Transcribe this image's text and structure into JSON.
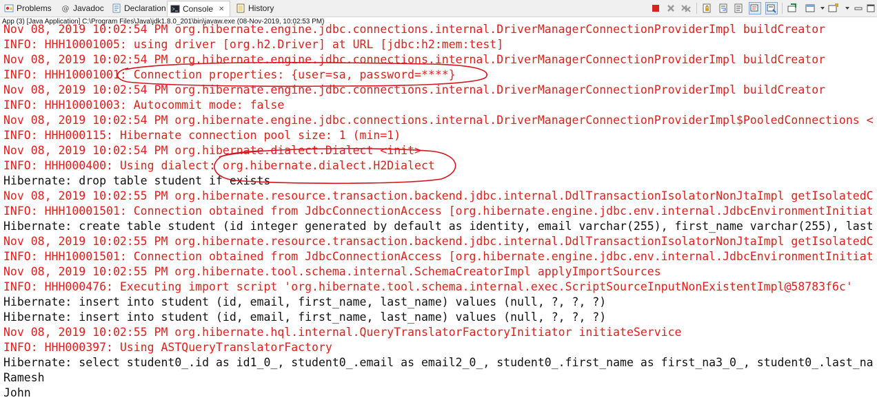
{
  "tabs": [
    {
      "label": "Problems",
      "icon": "problems-icon",
      "active": false
    },
    {
      "label": "Javadoc",
      "icon": "at-icon",
      "active": false
    },
    {
      "label": "Declaration",
      "icon": "declaration-icon",
      "active": false
    },
    {
      "label": "Console",
      "icon": "console-icon",
      "active": true
    },
    {
      "label": "History",
      "icon": "history-icon",
      "active": false
    }
  ],
  "console_description": "App (3) [Java Application] C:\\Program Files\\Java\\jdk1.8.0_201\\bin\\javaw.exe (08-Nov-2019, 10:02:53 PM)",
  "toolbar_icons": [
    "terminate-icon",
    "remove-launch-icon",
    "remove-all-launches-icon",
    "scroll-lock-icon",
    "word-wrap-icon",
    "show-on-stdout-icon",
    "show-on-stderr-icon",
    "pin-console-icon",
    "display-selected-console-icon",
    "open-console-icon",
    "view-menu-icon"
  ],
  "colors": {
    "stderr": "#e0201c",
    "stdout": "#111111",
    "annotation": "#d6141e"
  },
  "console_lines": [
    {
      "text": "Nov 08, 2019 10:02:54 PM org.hibernate.engine.jdbc.connections.internal.DriverManagerConnectionProviderImpl buildCreator",
      "stream": "err"
    },
    {
      "text": "INFO: HHH10001005: using driver [org.h2.Driver] at URL [jdbc:h2:mem:test]",
      "stream": "err"
    },
    {
      "text": "Nov 08, 2019 10:02:54 PM org.hibernate.engine.jdbc.connections.internal.DriverManagerConnectionProviderImpl buildCreator",
      "stream": "err"
    },
    {
      "text": "INFO: HHH10001001: Connection properties: {user=sa, password=****}",
      "stream": "err"
    },
    {
      "text": "Nov 08, 2019 10:02:54 PM org.hibernate.engine.jdbc.connections.internal.DriverManagerConnectionProviderImpl buildCreator",
      "stream": "err"
    },
    {
      "text": "INFO: HHH10001003: Autocommit mode: false",
      "stream": "err"
    },
    {
      "text": "Nov 08, 2019 10:02:54 PM org.hibernate.engine.jdbc.connections.internal.DriverManagerConnectionProviderImpl$PooledConnections <",
      "stream": "err"
    },
    {
      "text": "INFO: HHH000115: Hibernate connection pool size: 1 (min=1)",
      "stream": "err"
    },
    {
      "text": "Nov 08, 2019 10:02:54 PM org.hibernate.dialect.Dialect <init>",
      "stream": "err"
    },
    {
      "text": "INFO: HHH000400: Using dialect: org.hibernate.dialect.H2Dialect",
      "stream": "err"
    },
    {
      "text": "Hibernate: drop table student if exists",
      "stream": "out"
    },
    {
      "text": "Nov 08, 2019 10:02:55 PM org.hibernate.resource.transaction.backend.jdbc.internal.DdlTransactionIsolatorNonJtaImpl getIsolatedC",
      "stream": "err"
    },
    {
      "text": "INFO: HHH10001501: Connection obtained from JdbcConnectionAccess [org.hibernate.engine.jdbc.env.internal.JdbcEnvironmentInitiat",
      "stream": "err"
    },
    {
      "text": "Hibernate: create table student (id integer generated by default as identity, email varchar(255), first_name varchar(255), last",
      "stream": "out"
    },
    {
      "text": "Nov 08, 2019 10:02:55 PM org.hibernate.resource.transaction.backend.jdbc.internal.DdlTransactionIsolatorNonJtaImpl getIsolatedC",
      "stream": "err"
    },
    {
      "text": "INFO: HHH10001501: Connection obtained from JdbcConnectionAccess [org.hibernate.engine.jdbc.env.internal.JdbcEnvironmentInitiat",
      "stream": "err"
    },
    {
      "text": "Nov 08, 2019 10:02:55 PM org.hibernate.tool.schema.internal.SchemaCreatorImpl applyImportSources",
      "stream": "err"
    },
    {
      "text": "INFO: HHH000476: Executing import script 'org.hibernate.tool.schema.internal.exec.ScriptSourceInputNonExistentImpl@58783f6c'",
      "stream": "err"
    },
    {
      "text": "Hibernate: insert into student (id, email, first_name, last_name) values (null, ?, ?, ?)",
      "stream": "out"
    },
    {
      "text": "Hibernate: insert into student (id, email, first_name, last_name) values (null, ?, ?, ?)",
      "stream": "out"
    },
    {
      "text": "Nov 08, 2019 10:02:55 PM org.hibernate.hql.internal.QueryTranslatorFactoryInitiator initiateService",
      "stream": "err"
    },
    {
      "text": "INFO: HHH000397: Using ASTQueryTranslatorFactory",
      "stream": "err"
    },
    {
      "text": "Hibernate: select student0_.id as id1_0_, student0_.email as email2_0_, student0_.first_name as first_na3_0_, student0_.last_na",
      "stream": "out"
    },
    {
      "text": "Ramesh",
      "stream": "out"
    },
    {
      "text": "John",
      "stream": "out"
    }
  ]
}
